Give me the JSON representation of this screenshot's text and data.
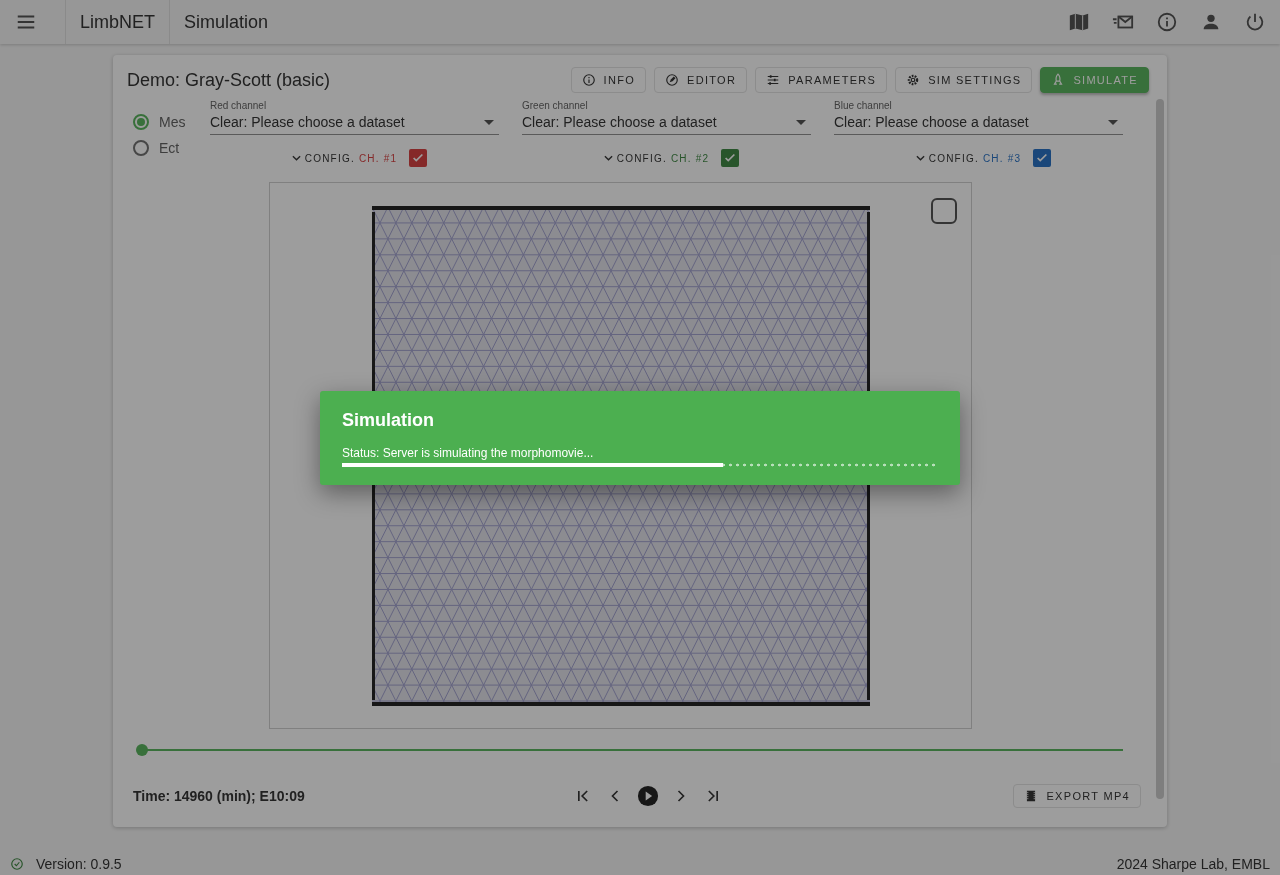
{
  "app_bar": {
    "brand": "LimbNET",
    "title": "Simulation"
  },
  "card": {
    "title": "Demo: Gray-Scott (basic)",
    "actions": [
      {
        "label": "INFO",
        "kind": "info",
        "primary": false
      },
      {
        "label": "EDITOR",
        "kind": "editor",
        "primary": false
      },
      {
        "label": "PARAMETERS",
        "kind": "parameters",
        "primary": false
      },
      {
        "label": "SIM SETTINGS",
        "kind": "settings",
        "primary": false
      },
      {
        "label": "SIMULATE",
        "kind": "simulate",
        "primary": true
      }
    ],
    "tissues": [
      {
        "label": "Mes",
        "selected": true
      },
      {
        "label": "Ect",
        "selected": false
      }
    ],
    "channels": [
      {
        "label": "Red channel",
        "value": "Clear: Please choose a dataset",
        "config": "CONFIG.",
        "tag": "CH. #1",
        "color": "#852929",
        "checked": true
      },
      {
        "label": "Green channel",
        "value": "Clear: Please choose a dataset",
        "config": "CONFIG.",
        "tag": "CH. #2",
        "color": "#28552b",
        "checked": true
      },
      {
        "label": "Blue channel",
        "value": "Clear: Please choose a dataset",
        "config": "CONFIG.",
        "tag": "CH. #3",
        "color": "#1a477a",
        "checked": true
      }
    ],
    "viewer": {
      "corner_checked": false
    },
    "timeline": {
      "level": 0
    },
    "time": "Time: 14960 (min); E10:09",
    "export": "EXPORT MP4"
  },
  "footer": {
    "version": "Version: 0.9.5",
    "credit": "2024 Sharpe Lab, EMBL"
  },
  "dialog": {
    "title": "Simulation",
    "status": "Status: Server is simulating the morphomovie...",
    "level": 0.64
  }
}
